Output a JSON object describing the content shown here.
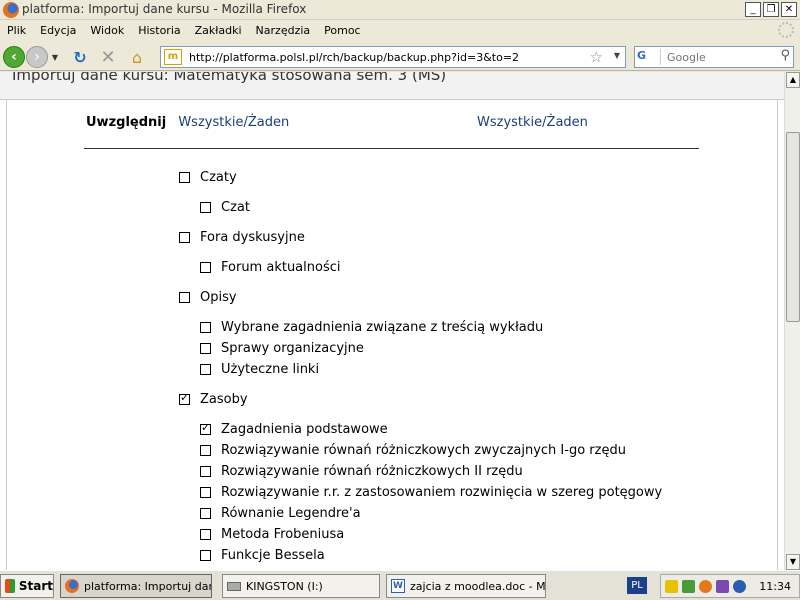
{
  "window": {
    "title": "platforma: Importuj dane kursu - Mozilla Firefox",
    "buttons": {
      "minimize": "_",
      "maximize": "❐",
      "close": "✕"
    }
  },
  "menubar": {
    "items": [
      "Plik",
      "Edycja",
      "Widok",
      "Historia",
      "Zakładki",
      "Narzędzia",
      "Pomoc"
    ]
  },
  "navbar": {
    "url": "http://platforma.polsl.pl/rch/backup/backup.php?id=3&to=2",
    "site_icon_text": "m",
    "search_engine": "G",
    "search_placeholder": "Google"
  },
  "page": {
    "heading": "Importuj dane kursu: Matematyka stosowana sem. 3 (MS)",
    "include_label": "Uwzględnij",
    "all_label": "Wszystkie",
    "none_label": "Żaden",
    "separator": "/",
    "modules": [
      {
        "label": "Czaty",
        "checked": false,
        "children": [
          {
            "label": "Czat",
            "checked": false
          }
        ]
      },
      {
        "label": "Fora dyskusyjne",
        "checked": false,
        "children": [
          {
            "label": "Forum aktualności",
            "checked": false
          }
        ]
      },
      {
        "label": "Opisy",
        "checked": false,
        "children": [
          {
            "label": "Wybrane zagadnienia związane z treścią wykładu",
            "checked": false
          },
          {
            "label": "Sprawy organizacyjne",
            "checked": false
          },
          {
            "label": "Użyteczne linki",
            "checked": false
          }
        ]
      },
      {
        "label": "Zasoby",
        "checked": true,
        "children": [
          {
            "label": "Zagadnienia podstawowe",
            "checked": true
          },
          {
            "label": "Rozwiązywanie równań różniczkowych zwyczajnych I-go rzędu",
            "checked": false
          },
          {
            "label": "Rozwiązywanie równań różniczkowych II rzędu",
            "checked": false
          },
          {
            "label": "Rozwiązywanie r.r. z zastosowaniem rozwinięcia w szereg potęgowy",
            "checked": false
          },
          {
            "label": "Równanie Legendre'a",
            "checked": false
          },
          {
            "label": "Metoda Frobeniusa",
            "checked": false
          },
          {
            "label": "Funkcje Bessela",
            "checked": false
          }
        ]
      }
    ]
  },
  "taskbar": {
    "start_label": "Start",
    "tasks": [
      "platforma: Importuj dan...",
      "KINGSTON (I:)",
      "zajcia z moodlea.doc - Mi..."
    ],
    "language": "PL",
    "clock": "11:34"
  }
}
